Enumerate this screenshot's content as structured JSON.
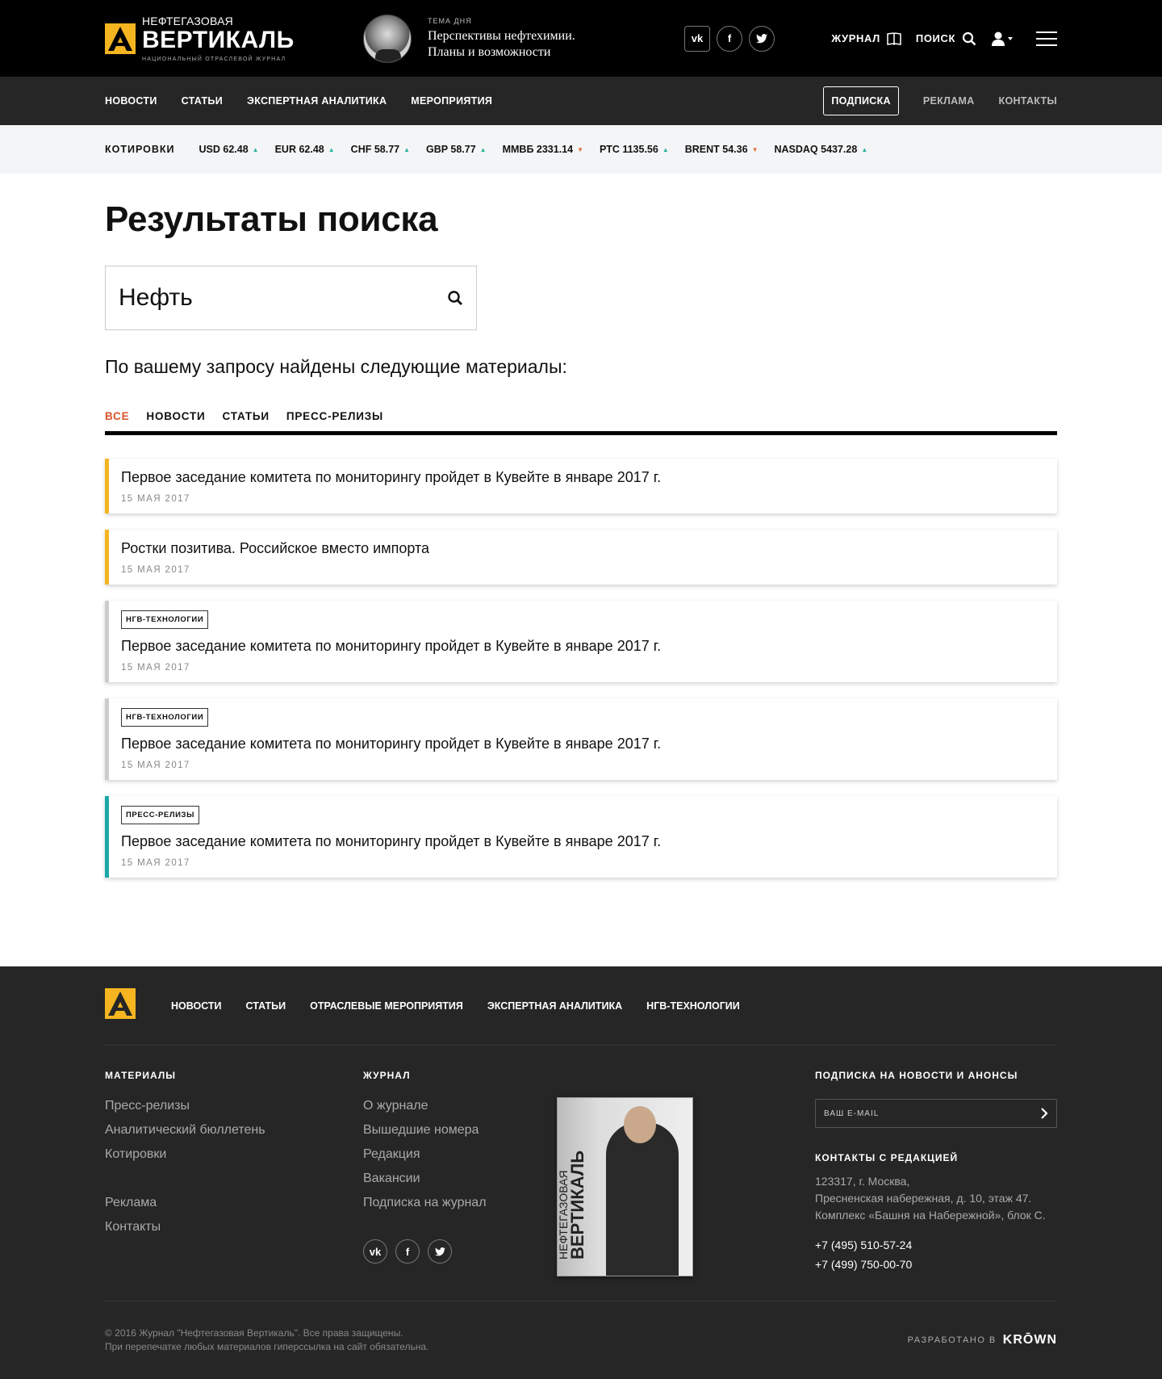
{
  "header": {
    "logo_small": "НЕФТЕГАЗОВАЯ",
    "logo_big": "ВЕРТИКАЛЬ",
    "logo_sub": "НАЦИОНАЛЬНЫЙ ОТРАСЛЕВОЙ ЖУРНАЛ",
    "topic_label": "ТЕМА ДНЯ",
    "topic_line1": "Перспективы нефтехимии.",
    "topic_line2": "Планы и возможности",
    "journal": "ЖУРНАЛ",
    "search": "ПОИСК"
  },
  "nav": {
    "items": [
      "НОВОСТИ",
      "СТАТЬИ",
      "ЭКСПЕРТНАЯ АНАЛИТИКА",
      "МЕРОПРИЯТИЯ"
    ],
    "subscribe": "ПОДПИСКА",
    "ads": "РЕКЛАМА",
    "contacts": "КОНТАКТЫ"
  },
  "quotes": {
    "label": "КОТИРОВКИ",
    "items": [
      {
        "text": "USD 62.48",
        "dir": "up"
      },
      {
        "text": "EUR 62.48",
        "dir": "up"
      },
      {
        "text": "CHF 58.77",
        "dir": "up"
      },
      {
        "text": "GBP 58.77",
        "dir": "up"
      },
      {
        "text": "ММВБ 2331.14",
        "dir": "down"
      },
      {
        "text": "РТС 1135.56",
        "dir": "up"
      },
      {
        "text": "BRENT 54.36",
        "dir": "down"
      },
      {
        "text": "NASDAQ 5437.28",
        "dir": "up"
      }
    ]
  },
  "main": {
    "title": "Результаты поиска",
    "query": "Нефть",
    "found_text": "По вашему запросу найдены следующие материалы:",
    "tabs": [
      "ВСЕ",
      "НОВОСТИ",
      "СТАТЬИ",
      "ПРЕСС-РЕЛИЗЫ"
    ],
    "results": [
      {
        "tag": "",
        "title": "Первое заседание комитета по мониторингу пройдет в Кувейте в январе 2017 г.",
        "date": "15 МАЯ 2017"
      },
      {
        "tag": "",
        "title": "Ростки позитива. Российское вместо импорта",
        "date": "15 МАЯ 2017"
      },
      {
        "tag": "НГВ-ТЕХНОЛОГИИ",
        "title": "Первое заседание комитета по мониторингу пройдет в Кувейте в январе 2017 г.",
        "date": "15 МАЯ 2017"
      },
      {
        "tag": "НГВ-ТЕХНОЛОГИИ",
        "title": "Первое заседание комитета по мониторингу пройдет в Кувейте в январе 2017 г.",
        "date": "15 МАЯ 2017"
      },
      {
        "tag": "ПРЕСС-РЕЛИЗЫ",
        "title": "Первое заседание комитета по мониторингу пройдет в Кувейте в январе 2017 г.",
        "date": "15 МАЯ 2017"
      }
    ]
  },
  "footer": {
    "nav": [
      "НОВОСТИ",
      "СТАТЬИ",
      "ОТРАСЛЕВЫЕ МЕРОПРИЯТИЯ",
      "ЭКСПЕРТНАЯ АНАЛИТИКА",
      "НГВ-ТЕХНОЛОГИИ"
    ],
    "materials_title": "МАТЕРИАЛЫ",
    "materials": [
      "Пресс-релизы",
      "Аналитический бюллетень",
      "Котировки",
      "Реклама",
      "Контакты"
    ],
    "journal_title": "ЖУРНАЛ",
    "journal": [
      "О журнале",
      "Вышедшие номера",
      "Редакция",
      "Вакансии",
      "Подписка на журнал"
    ],
    "cover_title_small": "НЕФТЕГАЗОВАЯ",
    "cover_title_big": "ВЕРТИКАЛЬ",
    "subscribe_title": "ПОДПИСКА НА НОВОСТИ И АНОНСЫ",
    "email_placeholder": "ВАШ E-MAIL",
    "contacts_title": "КОНТАКТЫ С РЕДАКЦИЕЙ",
    "address1": "123317, г. Москва,",
    "address2": "Пресненская набережная, д. 10, этаж 47.",
    "address3": "Комплекс «Башня на Набережной», блок С.",
    "phone1": "+7 (495) 510-57-24",
    "phone2": "+7 (499) 750-00-70",
    "copyright1": "© 2016 Журнал \"Нефтегазовая Вертикаль\". Все права защищены.",
    "copyright2": "При перепечатке любых материалов гиперссылка на сайт обязательна.",
    "dev_label": "РАЗРАБОТАНО В",
    "dev_name": "KRŌWN"
  },
  "colors": {
    "accent": "#d9532a",
    "yellow": "#f4b521",
    "teal": "#1aa7a8",
    "dark": "#262626"
  }
}
